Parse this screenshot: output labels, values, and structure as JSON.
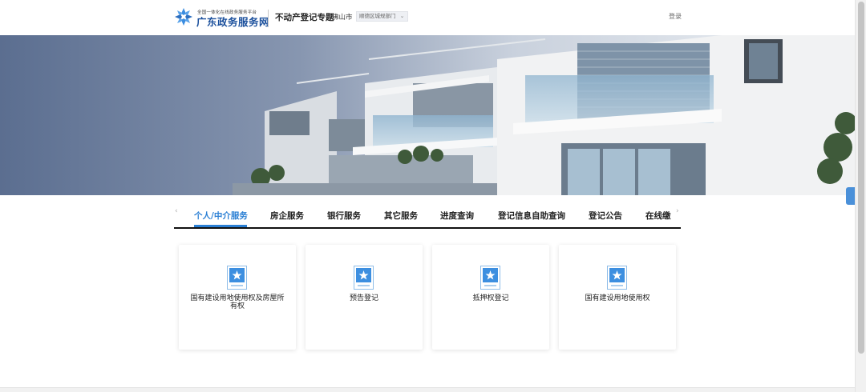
{
  "header": {
    "brand_sub": "全国一体化在线政务服务平台",
    "brand_main": "广东政务服务网",
    "topic_title": "不动产登记专题",
    "city": "佛山市",
    "dept_select": "顺德区城规部门",
    "login": "登录"
  },
  "tabs": [
    {
      "label": "个人/中介服务",
      "active": true
    },
    {
      "label": "房企服务",
      "active": false
    },
    {
      "label": "银行服务",
      "active": false
    },
    {
      "label": "其它服务",
      "active": false
    },
    {
      "label": "进度查询",
      "active": false
    },
    {
      "label": "登记信息自助查询",
      "active": false
    },
    {
      "label": "登记公告",
      "active": false
    },
    {
      "label": "在线缴",
      "active": false
    }
  ],
  "cards": [
    {
      "label": "国有建设用地使用权及房屋所有权",
      "icon": "document-star-icon"
    },
    {
      "label": "预告登记",
      "icon": "document-star-icon"
    },
    {
      "label": "抵押权登记",
      "icon": "document-star-icon"
    },
    {
      "label": "国有建设用地使用权",
      "icon": "document-star-icon"
    }
  ],
  "colors": {
    "accent": "#2a7fd4",
    "brand": "#1a4f9c",
    "icon_blue": "#3d8fe0"
  }
}
